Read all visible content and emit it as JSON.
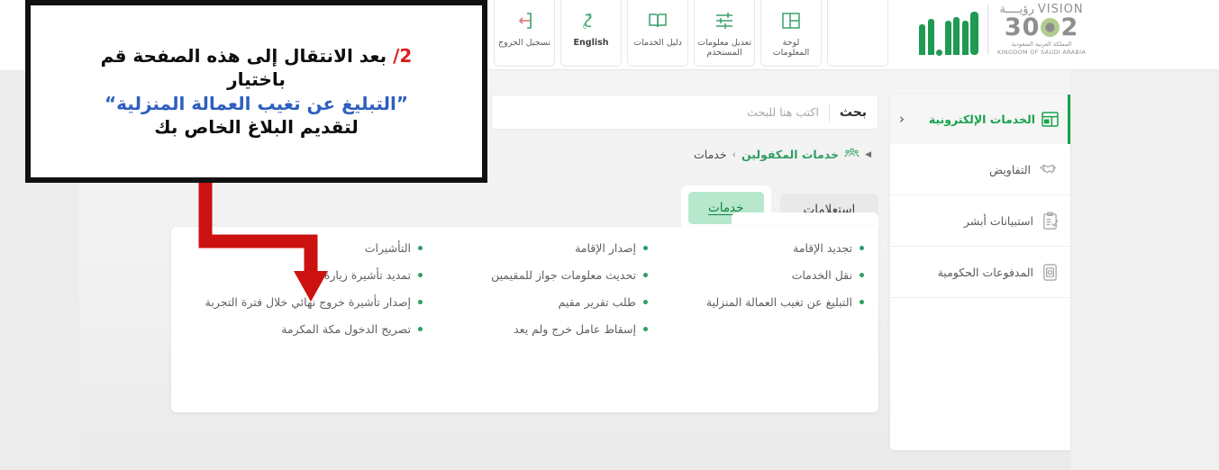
{
  "header": {
    "nav_tiles": [
      {
        "label": "تسجيل الخروج",
        "icon": "logout-icon"
      },
      {
        "label": "English",
        "icon": "language-icon"
      },
      {
        "label": "دليل الخدمات",
        "icon": "book-icon"
      },
      {
        "label": "تعديل معلومات المستخدم",
        "icon": "sliders-icon"
      },
      {
        "label": "لوحة المعلومات",
        "icon": "dashboard-icon"
      },
      {
        "label": "",
        "icon": "blank-icon"
      }
    ],
    "vision_logo": {
      "word": "VISION",
      "word_ar": "رؤيــــة",
      "num_left": "2",
      "num_right": "30",
      "sub_ar": "المملكة العربية السعودية",
      "sub_en": "KINGDOM OF SAUDI ARABIA"
    }
  },
  "search": {
    "button_label": "بحث",
    "placeholder": "اكتب هنا للبحث",
    "value": ""
  },
  "breadcrumb": {
    "icon": "users-group-icon",
    "link": "خدمات المكفولين",
    "separator": "›",
    "current": "خدمات"
  },
  "tabs": [
    {
      "label": "إستعلامات",
      "active": false
    },
    {
      "label": "خدمات",
      "active": true
    }
  ],
  "services": {
    "col1": [
      "التأشيرات",
      "تمديد تأشيرة زيارة",
      "إصدار تأشيرة خروج نهائي خلال فترة التجربة",
      "تصريح الدخول مكة المكرمة"
    ],
    "col2": [
      "إصدار الإقامة",
      "تحديث معلومات جواز للمقيمين",
      "طلب تقرير مقيم",
      "إسقاط عامل خرج ولم يعد"
    ],
    "col3": [
      "تجديد الإقامة",
      "نقل الخدمات",
      "التبليغ عن تغيب العمالة المنزلية"
    ]
  },
  "sidebar": {
    "header": {
      "title": "الخدمات الإلكترونية",
      "icon": "grid-panel-icon",
      "chevron": "‹"
    },
    "items": [
      {
        "label": "التفاويض",
        "icon": "handshake-icon"
      },
      {
        "label": "استبيانات أبشر",
        "icon": "clipboard-check-icon"
      },
      {
        "label": "المدفوعات الحكومية",
        "icon": "atm-cash-icon"
      }
    ]
  },
  "annotation": {
    "number": "2",
    "slash": "/",
    "line1": "بعد الانتقال إلى هذه الصفحة قم",
    "line2": "باختيار",
    "line3_quoted": "”التبليغ عن تغيب العمالة المنزلية“",
    "line4": "لتقديم البلاغ الخاص بك",
    "arrow_color": "#cc1111",
    "highlight_color": "#2e5fbe"
  },
  "colors": {
    "brand_green": "#16a34a",
    "accent_green": "#2f9e63",
    "tab_active_bg": "#b7e8cd",
    "annotation_red": "#cc1111"
  }
}
